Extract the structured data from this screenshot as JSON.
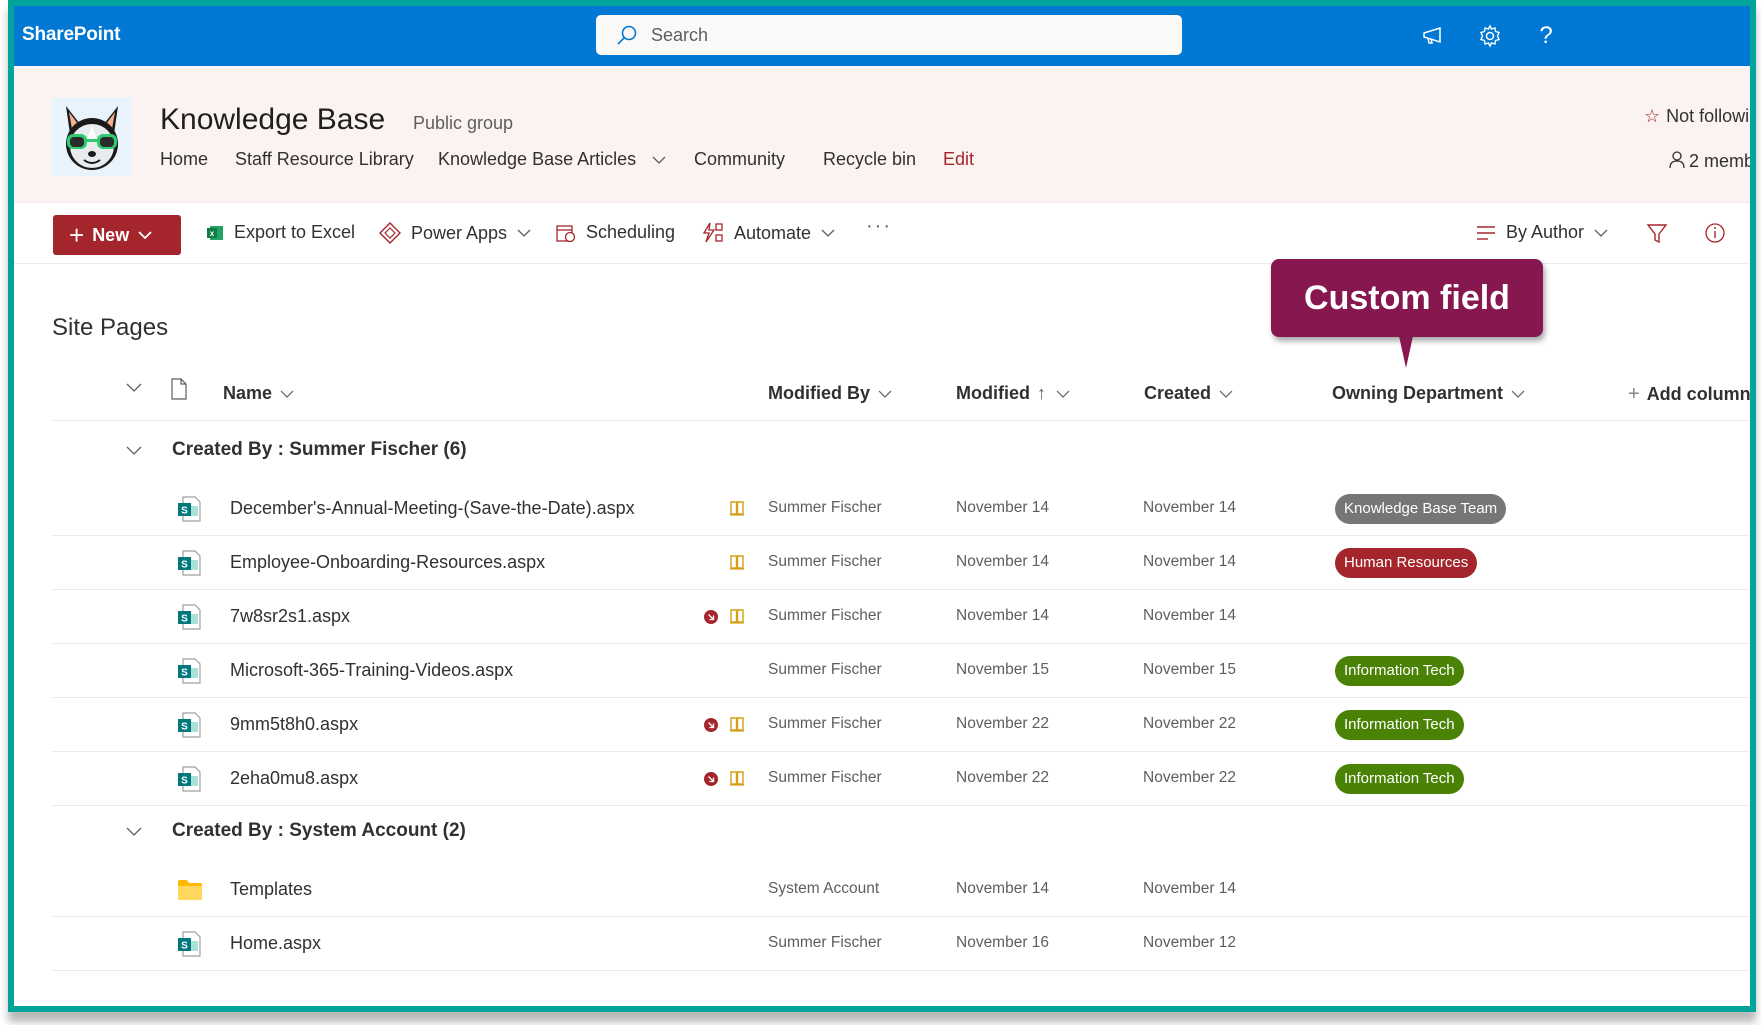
{
  "suitebar": {
    "brand": "SharePoint",
    "search_placeholder": "Search",
    "icons": [
      "megaphone-icon",
      "gear-icon",
      "help-icon"
    ],
    "help_glyph": "?"
  },
  "site": {
    "title": "Knowledge Base",
    "type": "Public group",
    "nav": [
      "Home",
      "Staff Resource Library",
      "Knowledge Base Articles",
      "Community",
      "Recycle bin",
      "Edit"
    ],
    "follow": "Not followi",
    "members": "2 memb"
  },
  "commandbar": {
    "new": "New",
    "export": "Export to Excel",
    "powerapps": "Power Apps",
    "scheduling": "Scheduling",
    "automate": "Automate",
    "more": "···",
    "view": "By Author"
  },
  "list": {
    "title": "Site Pages",
    "columns": {
      "name": "Name",
      "modified_by": "Modified By",
      "modified": "Modified",
      "modified_sort": "↑",
      "created": "Created",
      "owning_department": "Owning Department",
      "add_column": "Add column"
    },
    "groups": [
      {
        "title": "Created By : Summer Fischer (6)",
        "rows": [
          {
            "type": "page",
            "name": "December's-Annual-Meeting-(Save-the-Date).aspx",
            "flag": false,
            "book": true,
            "modified_by": "Summer Fischer",
            "modified": "November 14",
            "created": "November 14",
            "department": "Knowledge Base Team"
          },
          {
            "type": "page",
            "name": "Employee-Onboarding-Resources.aspx",
            "flag": false,
            "book": true,
            "modified_by": "Summer Fischer",
            "modified": "November 14",
            "created": "November 14",
            "department": "Human Resources"
          },
          {
            "type": "page",
            "name": "7w8sr2s1.aspx",
            "flag": true,
            "book": true,
            "modified_by": "Summer Fischer",
            "modified": "November 14",
            "created": "November 14",
            "department": ""
          },
          {
            "type": "page",
            "name": "Microsoft-365-Training-Videos.aspx",
            "flag": false,
            "book": false,
            "modified_by": "Summer Fischer",
            "modified": "November 15",
            "created": "November 15",
            "department": "Information Tech"
          },
          {
            "type": "page",
            "name": "9mm5t8h0.aspx",
            "flag": true,
            "book": true,
            "modified_by": "Summer Fischer",
            "modified": "November 22",
            "created": "November 22",
            "department": "Information Tech"
          },
          {
            "type": "page",
            "name": "2eha0mu8.aspx",
            "flag": true,
            "book": true,
            "modified_by": "Summer Fischer",
            "modified": "November 22",
            "created": "November 22",
            "department": "Information Tech"
          }
        ]
      },
      {
        "title": "Created By : System Account (2)",
        "rows": [
          {
            "type": "folder",
            "name": "Templates",
            "flag": false,
            "book": false,
            "modified_by": "System Account",
            "modified": "November 14",
            "created": "November 14",
            "department": ""
          },
          {
            "type": "page",
            "name": "Home.aspx",
            "flag": false,
            "book": false,
            "modified_by": "Summer Fischer",
            "modified": "November 16",
            "created": "November 12",
            "department": ""
          }
        ]
      }
    ]
  },
  "department_colors": {
    "Knowledge Base Team": "#767676",
    "Human Resources": "#A4262C",
    "Information Tech": "#498205"
  },
  "callout": {
    "text": "Custom field",
    "color": "#86184F"
  },
  "colors": {
    "suitebar": "#0078D4",
    "accent": "#A4262C",
    "frame": "#00A49A",
    "header_bg": "#FBF2F2"
  }
}
